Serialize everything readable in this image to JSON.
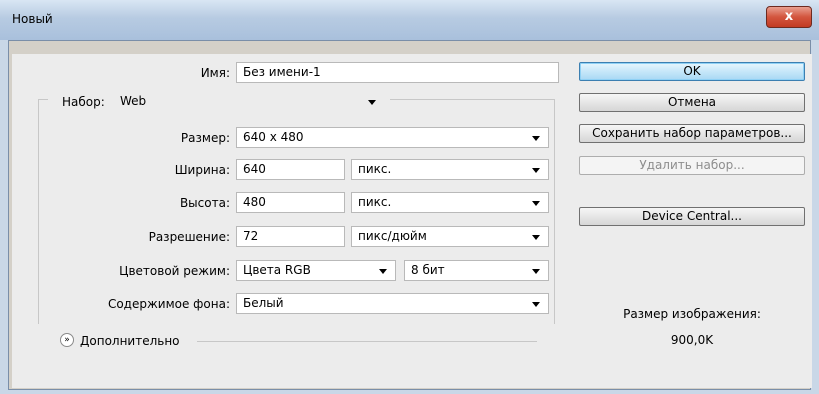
{
  "window": {
    "title": "Новый",
    "close_label": "x"
  },
  "form": {
    "name_label": "Имя:",
    "name_value": "Без имени-1",
    "preset_label": "Набор:",
    "preset_value": "Web",
    "size_label": "Размер:",
    "size_value": "640 x 480",
    "width_label": "Ширина:",
    "width_value": "640",
    "width_unit": "пикс.",
    "height_label": "Высота:",
    "height_value": "480",
    "height_unit": "пикс.",
    "resolution_label": "Разрешение:",
    "resolution_value": "72",
    "resolution_unit": "пикс/дюйм",
    "color_mode_label": "Цветовой режим:",
    "color_mode_value": "Цвета RGB",
    "bit_depth_value": "8 бит",
    "background_label": "Содержимое фона:",
    "background_value": "Белый",
    "advanced_label": "Дополнительно"
  },
  "buttons": {
    "ok": "OK",
    "cancel": "Отмена",
    "save_preset": "Сохранить набор параметров...",
    "delete_preset": "Удалить набор...",
    "device_central": "Device Central..."
  },
  "image_size": {
    "label": "Размер изображения:",
    "value": "900,0K"
  }
}
